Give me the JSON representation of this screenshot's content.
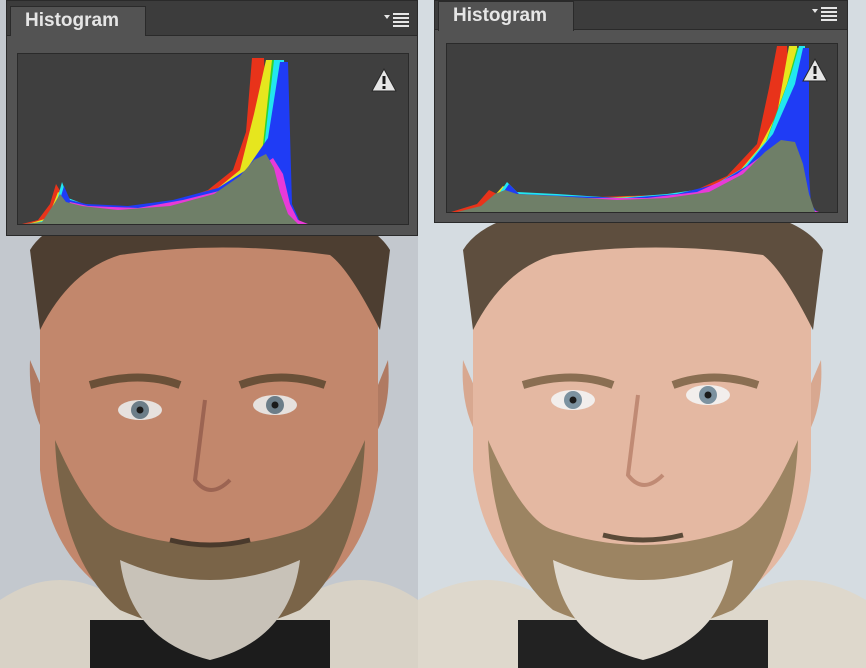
{
  "panels": {
    "left": {
      "title": "Histogram"
    },
    "right": {
      "title": "Histogram"
    }
  },
  "icons": {
    "menu": "panel-menu-icon",
    "warning": "cached-data-warning-icon"
  },
  "colors": {
    "panel_bg": "#535353",
    "tabbar_bg": "#3c3c3c",
    "histogram_bg": "#3f3f3f",
    "luminosity": "#6f7f68",
    "red": "#e8331a",
    "yellow": "#e6e61e",
    "green": "#2fd42f",
    "cyan": "#22e6f0",
    "blue": "#1f3cf5",
    "magenta": "#e83ad8",
    "backdrop": "#c9ced3"
  }
}
